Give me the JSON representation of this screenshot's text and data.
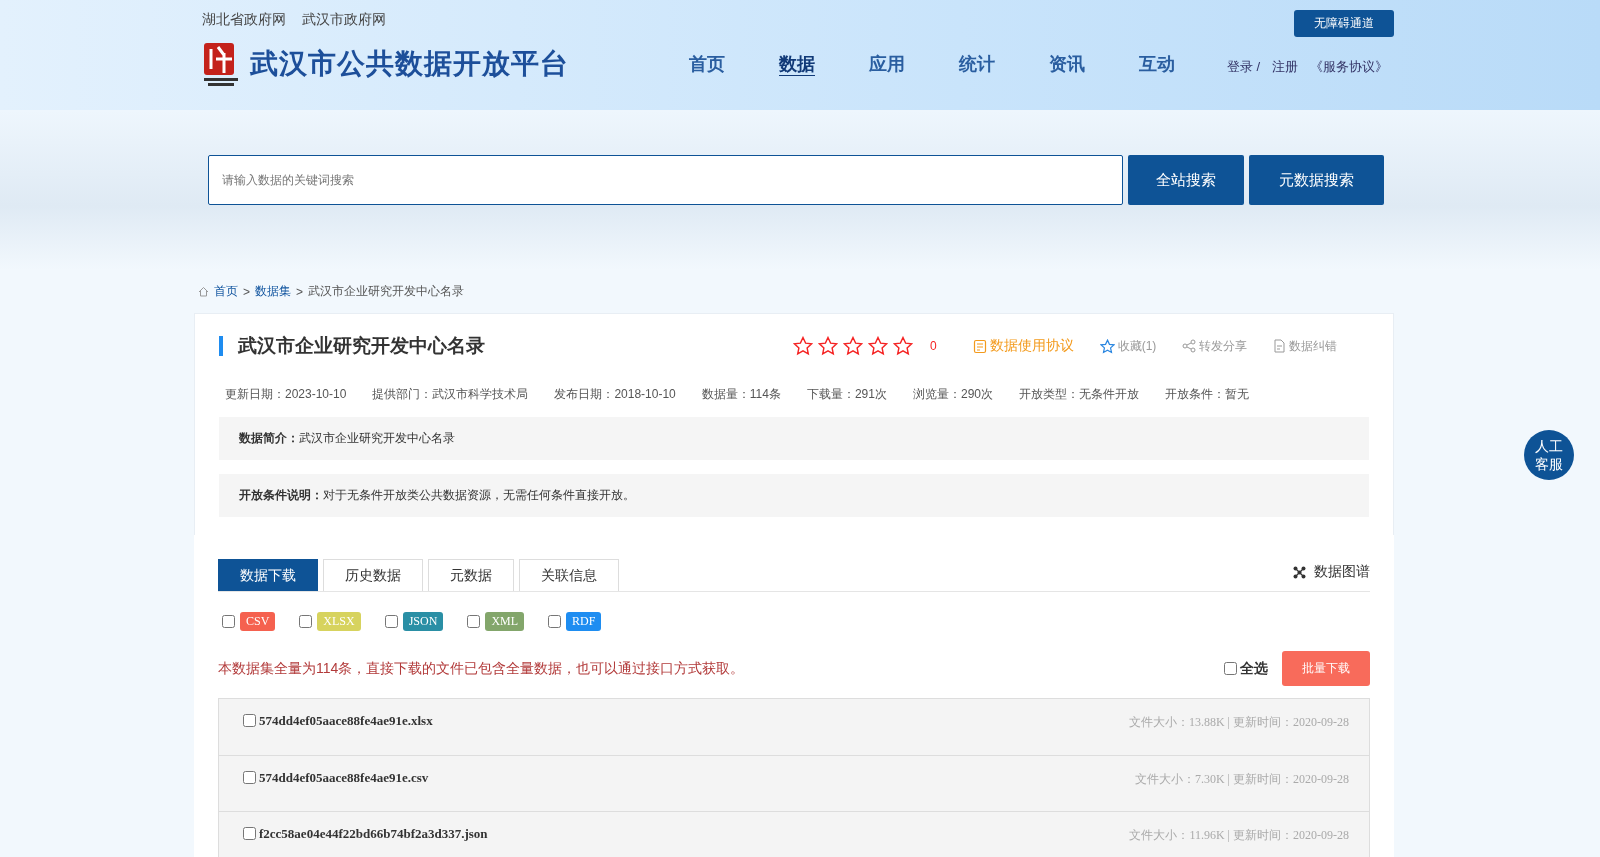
{
  "top_links": [
    "湖北省政府网",
    "武汉市政府网"
  ],
  "accessibility_button": "无障碍通道",
  "site_title": "武汉市公共数据开放平台",
  "nav": [
    {
      "label": "首页",
      "selected": false
    },
    {
      "label": "数据",
      "selected": true
    },
    {
      "label": "应用",
      "selected": false
    },
    {
      "label": "统计",
      "selected": false
    },
    {
      "label": "资讯",
      "selected": false
    },
    {
      "label": "互动",
      "selected": false
    }
  ],
  "user_links": {
    "login": "登录 /",
    "register": "注册",
    "agreement": "《服务协议》"
  },
  "search": {
    "placeholder": "请输入数据的关键词搜索",
    "buttons": [
      "全站搜索",
      "元数据搜索"
    ]
  },
  "breadcrumb": {
    "links": [
      "首页",
      "数据集"
    ],
    "separators": [
      ">",
      ">"
    ],
    "current": "武汉市企业研究开发中心名录"
  },
  "dataset": {
    "title": "武汉市企业研究开发中心名录",
    "stars": 0,
    "rating_count": "0",
    "actions": [
      {
        "kind": "agreement",
        "label": "数据使用协议"
      },
      {
        "kind": "favorite",
        "label": "收藏(1)"
      },
      {
        "kind": "share",
        "label": "转发分享"
      },
      {
        "kind": "report",
        "label": "数据纠错"
      }
    ],
    "meta": [
      "更新日期：2023-10-10",
      "提供部门：武汉市科学技术局",
      "发布日期：2018-10-10",
      "数据量：114条",
      "下载量：291次",
      "浏览量：290次",
      "开放类型：无条件开放",
      "开放条件：暂无"
    ],
    "info": [
      {
        "label": "数据简介：",
        "text": "武汉市企业研究开发中心名录"
      },
      {
        "label": "开放条件说明：",
        "text": "对于无条件开放类公共数据资源，无需任何条件直接开放。"
      }
    ]
  },
  "tabs": [
    {
      "label": "数据下载",
      "selected": true
    },
    {
      "label": "历史数据",
      "selected": false
    },
    {
      "label": "元数据",
      "selected": false
    },
    {
      "label": "关联信息",
      "selected": false
    }
  ],
  "graph_link": "数据图谱",
  "formats": [
    {
      "label": "CSV",
      "checked": false,
      "color": "#f5614f"
    },
    {
      "label": "XLSX",
      "checked": false,
      "color": "#d7d35e"
    },
    {
      "label": "JSON",
      "checked": false,
      "color": "#2a8fa5"
    },
    {
      "label": "XML",
      "checked": false,
      "color": "#83a66b"
    },
    {
      "label": "RDF",
      "checked": false,
      "color": "#1e8df1"
    }
  ],
  "notice": "本数据集全量为114条，直接下载的文件已包含全量数据，也可以通过接口方式获取。",
  "select_all": {
    "label": "全选",
    "checked": false
  },
  "batch_button": "批量下载",
  "files": [
    {
      "name": "574dd4ef05aace88fe4ae91e.xlsx",
      "checked": false,
      "info": "文件大小：13.88K | 更新时间：2020-09-28"
    },
    {
      "name": "574dd4ef05aace88fe4ae91e.csv",
      "checked": false,
      "info": "文件大小：7.30K | 更新时间：2020-09-28"
    },
    {
      "name": "f2cc58ae04e44f22bd66b74bf2a3d337.json",
      "checked": false,
      "info": "文件大小：11.96K | 更新时间：2020-09-28"
    }
  ],
  "service_button": "人工客服"
}
